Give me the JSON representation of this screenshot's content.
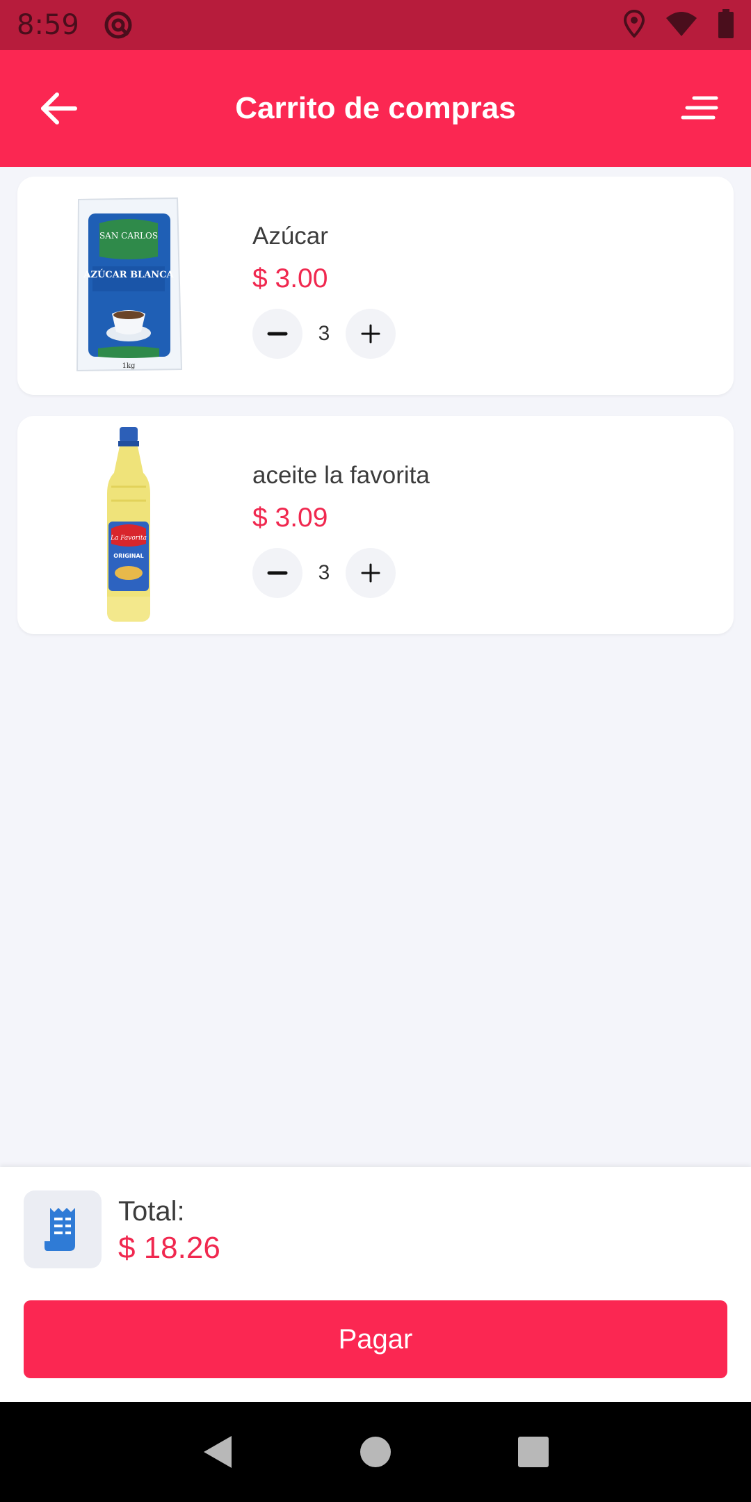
{
  "status_bar": {
    "time": "8:59",
    "icons": [
      "at-sign-icon",
      "location-icon",
      "wifi-icon",
      "battery-icon"
    ]
  },
  "app_bar": {
    "title": "Carrito de compras",
    "left_icon": "arrow-back-icon",
    "right_icon": "menu-icon",
    "color": "#fb2752"
  },
  "cart": {
    "items": [
      {
        "name": "Azúcar",
        "price": "$ 3.00",
        "quantity": "3",
        "image": "sugar-bag-image",
        "image_text": [
          "SAN CARLOS",
          "AZÚCAR BLANCA",
          "1kg"
        ]
      },
      {
        "name": "aceite la favorita",
        "price": "$ 3.09",
        "quantity": "3",
        "image": "oil-bottle-image",
        "image_text": [
          "La Favorita",
          "ORIGINAL"
        ]
      }
    ]
  },
  "summary": {
    "total_label": "Total:",
    "total_value": "$ 18.26",
    "icon": "receipt-icon"
  },
  "pay_button": {
    "label": "Pagar"
  },
  "nav_bar": {
    "icons": [
      "nav-back-icon",
      "nav-home-icon",
      "nav-recents-icon"
    ]
  },
  "colors": {
    "accent": "#fb2752",
    "price": "#f0284f",
    "status_bar": "#b71c3c"
  }
}
